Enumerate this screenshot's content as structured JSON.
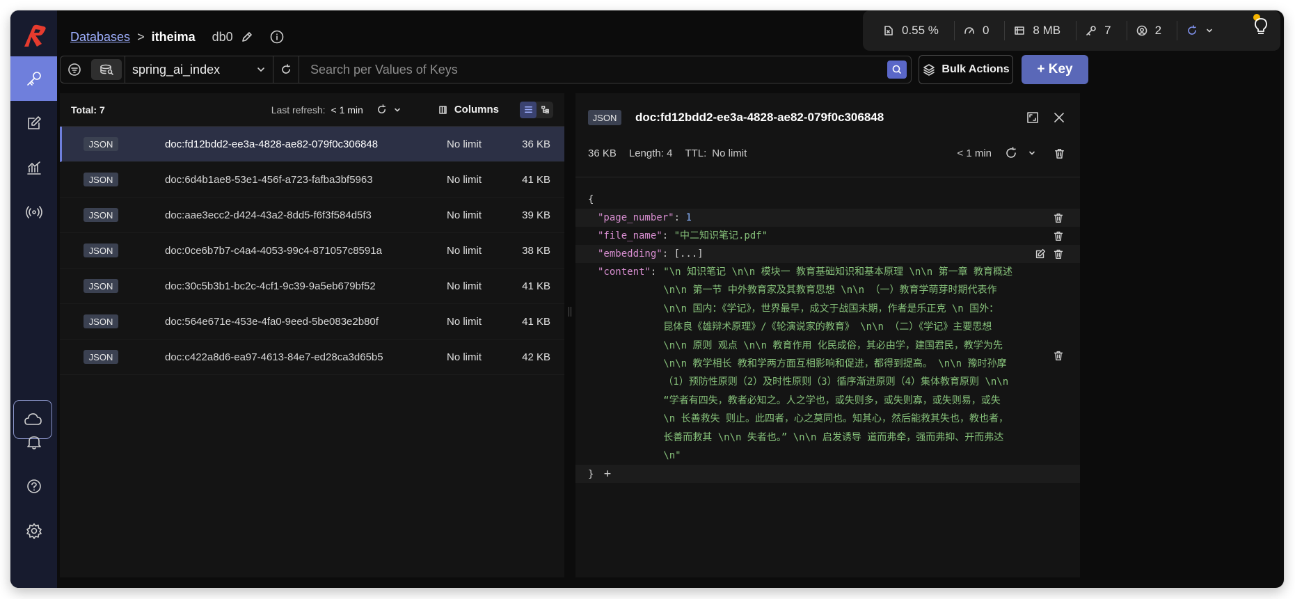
{
  "breadcrumb": {
    "root": "Databases",
    "separator": ">",
    "current": "itheima",
    "db": "db0"
  },
  "stats": [
    {
      "icon": "cpu-icon",
      "value": "0.55 %"
    },
    {
      "icon": "gauge-icon",
      "value": "0"
    },
    {
      "icon": "memory-icon",
      "value": "8 MB"
    },
    {
      "icon": "key-icon",
      "value": "7"
    },
    {
      "icon": "users-icon",
      "value": "2"
    }
  ],
  "filter": {
    "index": "spring_ai_index",
    "search_placeholder": "Search per Values of Keys"
  },
  "buttons": {
    "bulk_actions": "Bulk Actions",
    "add_key": "+ Key"
  },
  "list": {
    "total": "Total: 7",
    "last_refresh_label": "Last refresh:",
    "last_refresh_value": "< 1 min",
    "columns": "Columns",
    "rows": [
      {
        "type": "JSON",
        "key": "doc:fd12bdd2-ee3a-4828-ae82-079f0c306848",
        "ttl": "No limit",
        "size": "36 KB",
        "selected": true
      },
      {
        "type": "JSON",
        "key": "doc:6d4b1ae8-53e1-456f-a723-fafba3bf5963",
        "ttl": "No limit",
        "size": "41 KB"
      },
      {
        "type": "JSON",
        "key": "doc:aae3ecc2-d424-43a2-8dd5-f6f3f584d5f3",
        "ttl": "No limit",
        "size": "39 KB"
      },
      {
        "type": "JSON",
        "key": "doc:0ce6b7b7-c4a4-4053-99c4-871057c8591a",
        "ttl": "No limit",
        "size": "38 KB"
      },
      {
        "type": "JSON",
        "key": "doc:30c5b3b1-bc2c-4cf1-9c39-9a5eb679bf52",
        "ttl": "No limit",
        "size": "41 KB"
      },
      {
        "type": "JSON",
        "key": "doc:564e671e-453e-4fa0-9eed-5be083e2b80f",
        "ttl": "No limit",
        "size": "41 KB"
      },
      {
        "type": "JSON",
        "key": "doc:c422a8d6-ea97-4613-84e7-ed28ca3d65b5",
        "ttl": "No limit",
        "size": "42 KB"
      }
    ]
  },
  "detail": {
    "type": "JSON",
    "key": "doc:fd12bdd2-ee3a-4828-ae82-079f0c306848",
    "size": "36 KB",
    "length": "Length: 4",
    "ttl_label": "TTL:",
    "ttl_value": "No limit",
    "refreshed": "< 1 min",
    "json": {
      "open": "{",
      "close": "}",
      "add": "+",
      "page_number_key": "\"page_number\"",
      "page_number_val": "1",
      "file_name_key": "\"file_name\"",
      "file_name_val": "\"中二知识笔记.pdf\"",
      "embedding_key": "\"embedding\"",
      "embedding_val": "[...]",
      "content_key": "\"content\"",
      "content_lines": [
        "\"\\n 知识笔记 \\n\\n 模块一 教育基础知识和基本原理 \\n\\n 第一章 教育概述",
        "\\n\\n 第一节 中外教育家及其教育思想 \\n\\n （一）教育学萌芽时期代表作",
        "\\n\\n 国内：《学记》，世界最早，成文于战国末期，作者是乐正克 \\n 国外：",
        "昆体良《雄辩术原理》/《轮演说家的教育》 \\n\\n （二）《学记》主要思想",
        "\\n\\n 原则 观点 \\n\\n 教育作用 化民成俗，其必由学，建国君民，教学为先",
        "\\n\\n 教学相长 教和学两方面互相影响和促进，都得到提高。 \\n\\n 豫时孙摩",
        "（1）预防性原则（2）及时性原则（3）循序渐进原则（4）集体教育原则 \\n\\n",
        "“学者有四失，教者必知之。人之学也，或失则多，或失则寡，或失则易，或失",
        "\\n 长善救失 则止。此四者，心之莫同也。知其心，然后能救其失也，教也者，",
        "长善而救其 \\n\\n 失者也。” \\n\\n 启发诱导 道而弗牵，强而弗抑、开而弗达",
        "\\n\""
      ]
    }
  }
}
